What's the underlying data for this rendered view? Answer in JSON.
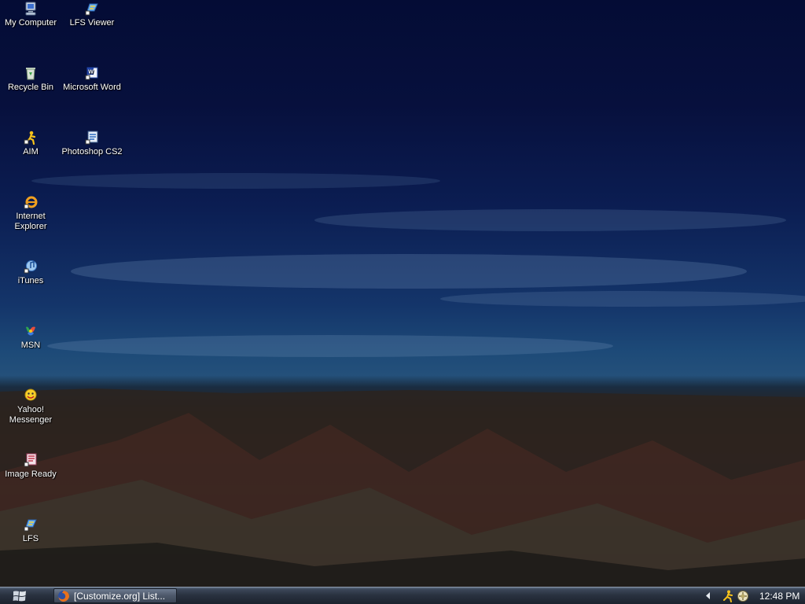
{
  "desktop": {
    "icons": [
      {
        "label": "My Computer",
        "icon": "my-computer-icon"
      },
      {
        "label": "LFS Viewer",
        "icon": "lfs-viewer-icon"
      },
      {
        "label": "Recycle Bin",
        "icon": "recycle-bin-icon"
      },
      {
        "label": "Microsoft Word",
        "icon": "microsoft-word-icon"
      },
      {
        "label": "AIM",
        "icon": "aim-icon"
      },
      {
        "label": "Photoshop CS2",
        "icon": "photoshop-icon"
      },
      {
        "label": "Internet Explorer",
        "icon": "internet-explorer-icon"
      },
      {
        "label": "iTunes",
        "icon": "itunes-icon"
      },
      {
        "label": "MSN",
        "icon": "msn-icon"
      },
      {
        "label": "Yahoo! Messenger",
        "icon": "yahoo-messenger-icon"
      },
      {
        "label": "Image Ready",
        "icon": "image-ready-icon"
      },
      {
        "label": "LFS",
        "icon": "lfs-icon"
      }
    ]
  },
  "taskbar": {
    "start_icon": "windows-logo-icon",
    "task_label": "[Customize.org] List...",
    "task_icon": "firefox-icon",
    "tray_icons": [
      "tray-expand-arrow-icon",
      "aim-tray-icon",
      "network-tray-icon"
    ],
    "clock": "12:48 PM"
  },
  "colors": {
    "sky_top": "#040c35",
    "sky_horizon": "#24507a",
    "canyon": "#3a2620",
    "taskbar": "#2a3240"
  }
}
